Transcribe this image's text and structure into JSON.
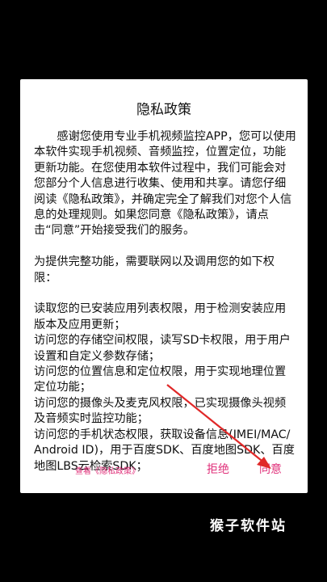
{
  "dialog": {
    "title": "隐私政策",
    "intro": "感谢您使用专业手机视频监控APP，您可以使用本软件实现手机视频、音频监控，位置定位，功能更新功能。在您使用本软件过程中，我们可能会对您部分个人信息进行收集、使用和共享。请您仔细阅读《隐私政策》，并确定完全了解我们对您个人信息的处理规则。如果您同意《隐私政策》，请点击“同意”开始接受我们的服务。",
    "permission_intro": "为提供完整功能，需要联网以及调用您的如下权限：",
    "permissions": [
      "读取您的已安装应用列表权限，用于检测安装应用版本及应用更新；",
      "访问您的存储空间权限，读写SD卡权限，用于用户设置和自定义参数存储；",
      "访问您的位置信息和定位权限，用于实现地理位置定位功能；",
      "访问您的摄像头及麦克风权限，已实现摄像头视频及音频实时监控功能；",
      "访问您的手机状态权限，获取设备信息(IMEI/MAC/Android ID)，用于百度SDK、百度地图SDK、百度地图LBS云检索SDK；"
    ],
    "view_policy_label": "查看《隐私政策》",
    "reject_label": "拒绝",
    "agree_label": "同意"
  },
  "watermark": "猴子软件站",
  "colors": {
    "background": "#000000",
    "dialog": "#ffffff",
    "accent": "#e0307a",
    "annotation_arrow": "#e02828"
  }
}
